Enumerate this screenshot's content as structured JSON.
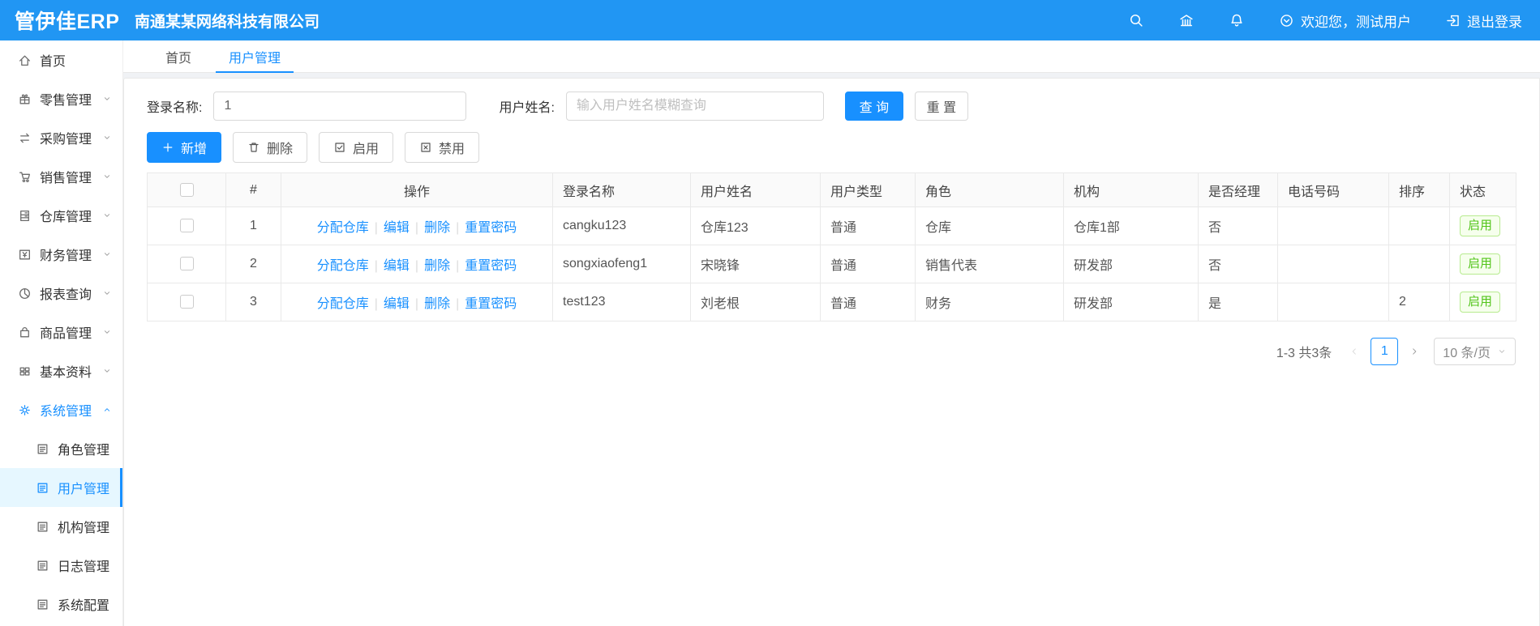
{
  "header": {
    "logo": "管伊佳ERP",
    "company": "南通某某网络科技有限公司",
    "icons": [
      "search-icon",
      "bank-icon",
      "bell-icon"
    ],
    "welcome_icon": "circle-down-icon",
    "welcome": "欢迎您，测试用户",
    "logout_icon": "logout-icon",
    "logout": "退出登录"
  },
  "sidebar": {
    "items": [
      {
        "label": "首页",
        "icon": "home-icon"
      },
      {
        "label": "零售管理",
        "icon": "retail-icon",
        "chevron": "down"
      },
      {
        "label": "采购管理",
        "icon": "purchase-icon",
        "chevron": "down"
      },
      {
        "label": "销售管理",
        "icon": "sales-icon",
        "chevron": "down"
      },
      {
        "label": "仓库管理",
        "icon": "warehouse-icon",
        "chevron": "down"
      },
      {
        "label": "财务管理",
        "icon": "finance-icon",
        "chevron": "down"
      },
      {
        "label": "报表查询",
        "icon": "report-icon",
        "chevron": "down"
      },
      {
        "label": "商品管理",
        "icon": "goods-icon",
        "chevron": "down"
      },
      {
        "label": "基本资料",
        "icon": "basic-icon",
        "chevron": "down"
      },
      {
        "label": "系统管理",
        "icon": "system-icon",
        "chevron": "up",
        "active": true,
        "children": [
          {
            "label": "角色管理",
            "icon": "doc-icon"
          },
          {
            "label": "用户管理",
            "icon": "doc-icon",
            "selected": true
          },
          {
            "label": "机构管理",
            "icon": "doc-icon"
          },
          {
            "label": "日志管理",
            "icon": "doc-icon"
          },
          {
            "label": "系统配置",
            "icon": "doc-icon"
          }
        ]
      }
    ]
  },
  "tabs": [
    {
      "label": "首页"
    },
    {
      "label": "用户管理",
      "active": true
    }
  ],
  "search": {
    "login_label": "登录名称:",
    "login_value": "1",
    "name_label": "用户姓名:",
    "name_placeholder": "输入用户姓名模糊查询",
    "query_button": "查 询",
    "reset_button": "重 置"
  },
  "toolbar": {
    "add": "新增",
    "delete": "删除",
    "enable": "启用",
    "disable": "禁用"
  },
  "table": {
    "columns": [
      "#",
      "操作",
      "登录名称",
      "用户姓名",
      "用户类型",
      "角色",
      "机构",
      "是否经理",
      "电话号码",
      "排序",
      "状态"
    ],
    "op_links": [
      "分配仓库",
      "编辑",
      "删除",
      "重置密码"
    ],
    "rows": [
      {
        "index": "1",
        "login": "cangku123",
        "name": "仓库123",
        "type": "普通",
        "role": "仓库",
        "org": "仓库1部",
        "manager": "否",
        "phone": "",
        "sort": "",
        "status": "启用"
      },
      {
        "index": "2",
        "login": "songxiaofeng1",
        "name": "宋晓锋",
        "type": "普通",
        "role": "销售代表",
        "org": "研发部",
        "manager": "否",
        "phone": "",
        "sort": "",
        "status": "启用"
      },
      {
        "index": "3",
        "login": "test123",
        "name": "刘老根",
        "type": "普通",
        "role": "财务",
        "org": "研发部",
        "manager": "是",
        "phone": "",
        "sort": "2",
        "status": "启用"
      }
    ]
  },
  "pagination": {
    "total": "1-3 共3条",
    "prev_icon": "chevron-left-icon",
    "current": "1",
    "next_icon": "chevron-right-icon",
    "page_size": "10 条/页"
  },
  "colors": {
    "primary": "#1890ff",
    "header_bg": "#2196f3",
    "selected_menu_bg": "#e6f7ff",
    "status_green": "#52c41a",
    "status_green_bg": "#f6ffed",
    "status_green_border": "#b7eb8f",
    "table_header_bg": "#fafafa"
  }
}
